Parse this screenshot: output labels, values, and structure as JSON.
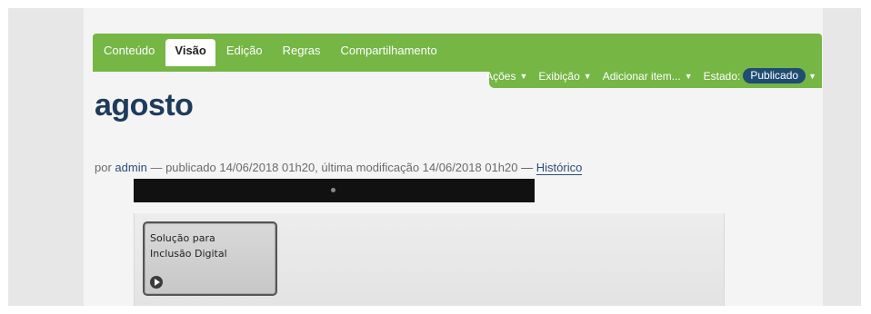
{
  "toolbar": {
    "tabs": [
      {
        "label": "Conteúdo",
        "active": false
      },
      {
        "label": "Visão",
        "active": true
      },
      {
        "label": "Edição",
        "active": false
      },
      {
        "label": "Regras",
        "active": false
      },
      {
        "label": "Compartilhamento",
        "active": false
      }
    ],
    "menu": {
      "actions_label": "Ações",
      "display_label": "Exibição",
      "add_item_label": "Adicionar item...",
      "state_label": "Estado:",
      "state_value": "Publicado",
      "caret_icon": "caret-down-icon"
    },
    "colors": {
      "toolbar_green": "#75b645",
      "state_badge": "#1f4c73",
      "title": "#1e3b5b"
    }
  },
  "main": {
    "title": "agosto",
    "byline": {
      "prefix": "por",
      "author": "admin",
      "published_text": "— publicado 14/06/2018 01h20, última modificação 14/06/2018 01h20",
      "separator": "—",
      "history_label": "Histórico"
    },
    "card": {
      "line1": "Solução para",
      "line2": "Inclusão Digital",
      "play_icon": "play-circle-icon"
    }
  }
}
